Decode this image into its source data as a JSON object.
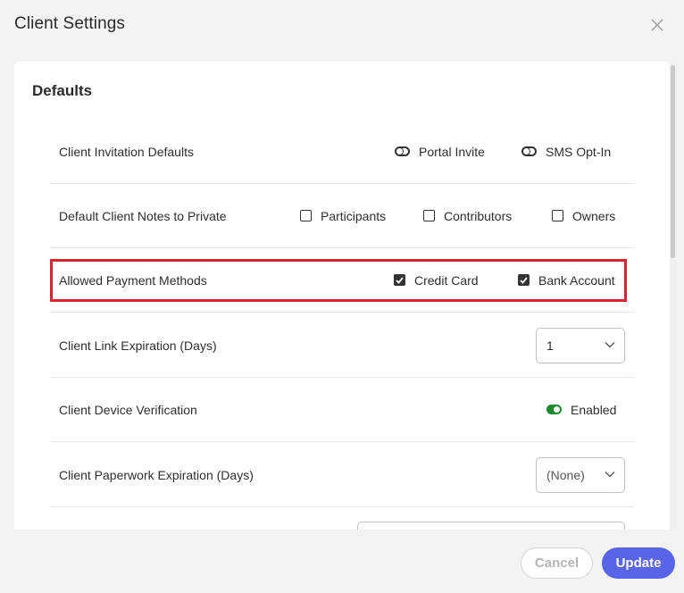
{
  "dialog": {
    "title": "Client Settings"
  },
  "defaults": {
    "title": "Defaults",
    "invitation": {
      "label": "Client Invitation Defaults",
      "portal_invite": "Portal Invite",
      "sms_opt_in": "SMS Opt-In"
    },
    "notes_private": {
      "label": "Default Client Notes to Private",
      "participants": "Participants",
      "contributors": "Contributors",
      "owners": "Owners"
    },
    "payment_methods": {
      "label": "Allowed Payment Methods",
      "credit_card": "Credit Card",
      "bank_account": "Bank Account"
    },
    "link_expiration": {
      "label": "Client Link Expiration (Days)",
      "value": "1"
    },
    "device_verification": {
      "label": "Client Device Verification",
      "status": "Enabled"
    },
    "paperwork_expiration": {
      "label": "Client Paperwork Expiration (Days)",
      "value": "(None)"
    }
  },
  "footer": {
    "cancel": "Cancel",
    "update": "Update"
  },
  "colors": {
    "accent": "#5865e8",
    "highlight": "#d9232e",
    "toggle_on": "#1e8a2e"
  }
}
